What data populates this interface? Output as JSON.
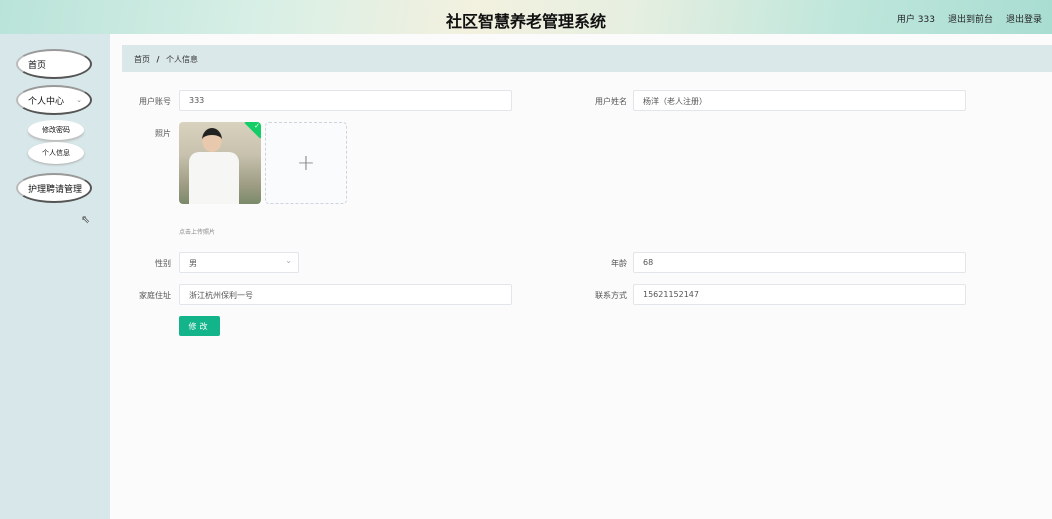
{
  "header": {
    "title": "社区智慧养老管理系统",
    "user": "用户 333",
    "to_front": "退出到前台",
    "logout": "退出登录"
  },
  "sidebar": {
    "home": "首页",
    "center": "个人中心",
    "change_pwd": "修改密码",
    "profile": "个人信息",
    "nursing": "护理聘请管理"
  },
  "breadcrumb": {
    "home": "首页",
    "sep": "/",
    "current": "个人信息"
  },
  "form": {
    "account_label": "用户账号",
    "account": "333",
    "name_label": "用户姓名",
    "name": "杨洋（老人注册）",
    "photo_label": "照片",
    "photo_hint": "点击上传照片",
    "gender_label": "性别",
    "gender": "男",
    "age_label": "年龄",
    "age": "68",
    "address_label": "家庭住址",
    "address": "浙江杭州保利一号",
    "phone_label": "联系方式",
    "phone": "15621152147",
    "submit": "修改"
  },
  "colors": {
    "accent": "#13b48a",
    "sidebar": "#d8e8ea"
  }
}
